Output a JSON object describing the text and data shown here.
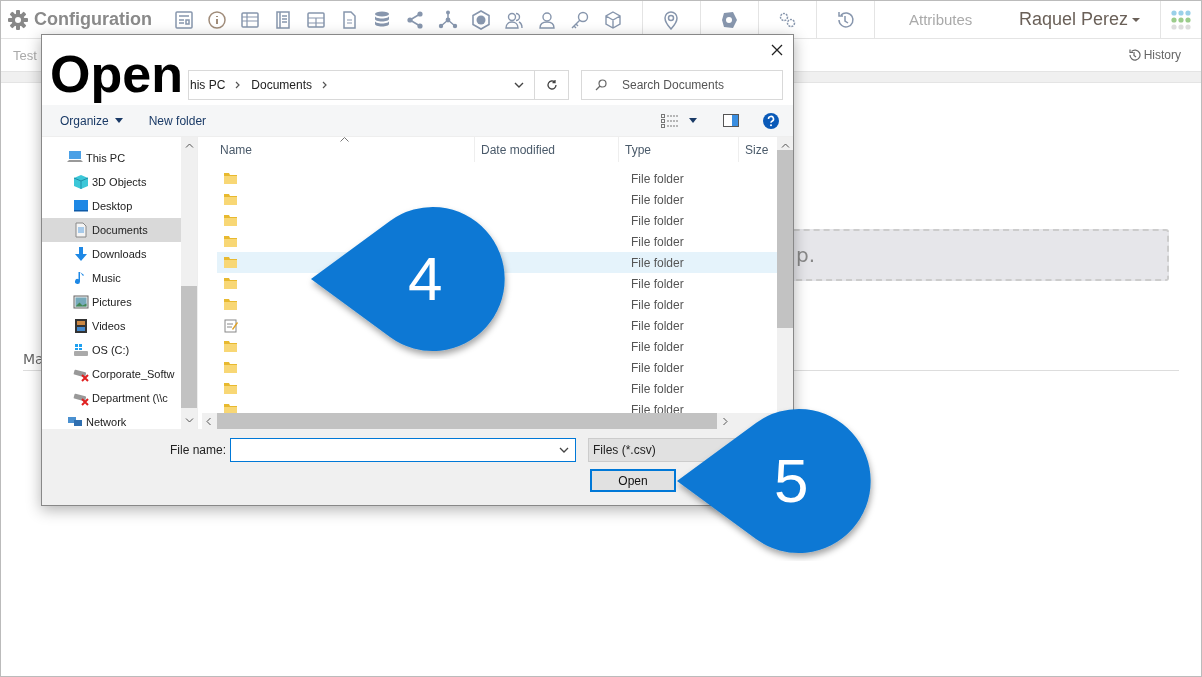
{
  "app": {
    "title": "Configuration",
    "tab_label": "Attributes",
    "user": "Raquel Perez"
  },
  "subbar": {
    "left_label": "Test",
    "history_link": "History"
  },
  "page": {
    "section_label": "Ma",
    "drop_zone_text": "p."
  },
  "dialog": {
    "title_overlay": "Open",
    "breadcrumb": [
      "his PC",
      "Documents"
    ],
    "search": {
      "placeholder": "Search Documents"
    },
    "toolbar": {
      "organize": "Organize",
      "new_folder": "New folder"
    },
    "nav": [
      {
        "label": "This PC",
        "kind": "pc",
        "selected": false,
        "children": [
          {
            "label": "3D Objects",
            "kind": "cube",
            "selected": false
          },
          {
            "label": "Desktop",
            "kind": "desktop",
            "selected": false
          },
          {
            "label": "Documents",
            "kind": "documents",
            "selected": true
          },
          {
            "label": "Downloads",
            "kind": "download",
            "selected": false
          },
          {
            "label": "Music",
            "kind": "music",
            "selected": false
          },
          {
            "label": "Pictures",
            "kind": "pictures",
            "selected": false
          },
          {
            "label": "Videos",
            "kind": "videos",
            "selected": false
          },
          {
            "label": "OS (C:)",
            "kind": "drive",
            "selected": false
          },
          {
            "label": "Corporate_Softw",
            "kind": "netdrive",
            "selected": false
          },
          {
            "label": "Department (\\\\c",
            "kind": "netdrive",
            "selected": false
          }
        ]
      },
      {
        "label": "Network",
        "kind": "network",
        "selected": false
      }
    ],
    "columns": [
      "Name",
      "Date modified",
      "Type",
      "Size"
    ],
    "rows": [
      {
        "kind": "folder",
        "type": "File folder",
        "selected": false
      },
      {
        "kind": "folder",
        "type": "File folder",
        "selected": false
      },
      {
        "kind": "folder",
        "type": "File folder",
        "selected": false
      },
      {
        "kind": "folder",
        "type": "File folder",
        "selected": false
      },
      {
        "kind": "folder",
        "type": "File folder",
        "selected": true
      },
      {
        "kind": "folder",
        "type": "File folder",
        "selected": false
      },
      {
        "kind": "folder",
        "type": "File folder",
        "selected": false
      },
      {
        "kind": "note",
        "type": "File folder",
        "selected": false
      },
      {
        "kind": "folder",
        "type": "File folder",
        "selected": false
      },
      {
        "kind": "folder",
        "type": "File folder",
        "selected": false
      },
      {
        "kind": "folder",
        "type": "File folder",
        "selected": false
      },
      {
        "kind": "folder",
        "type": "File folder",
        "selected": false
      }
    ],
    "file_name_label": "File name:",
    "filter": "Files (*.csv)",
    "open_button": "Open"
  },
  "callouts": [
    {
      "number": "4"
    },
    {
      "number": "5"
    }
  ]
}
